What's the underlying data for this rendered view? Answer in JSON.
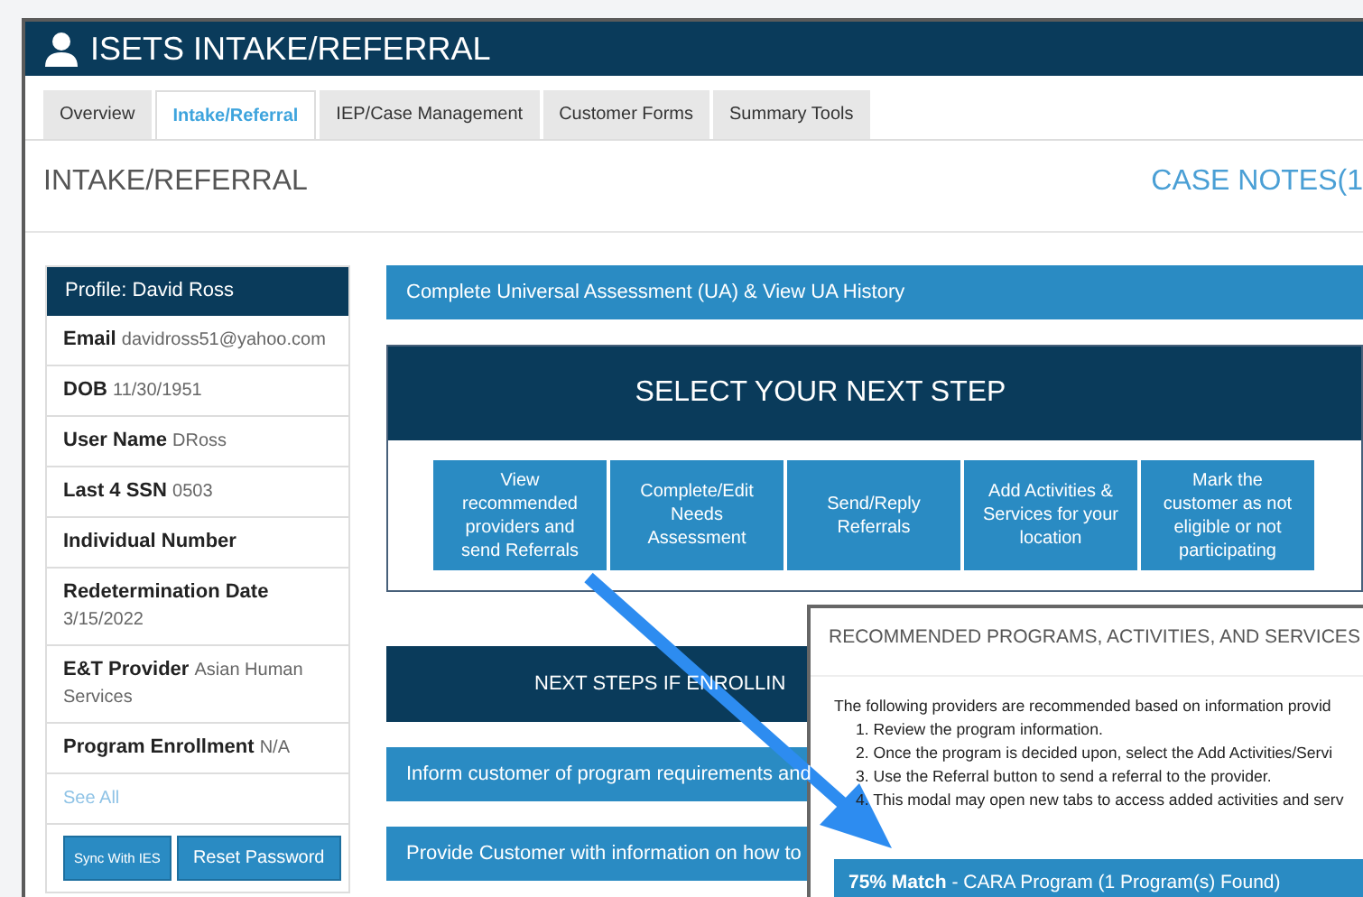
{
  "header": {
    "title": "ISETS INTAKE/REFERRAL"
  },
  "tabs": [
    {
      "label": "Overview",
      "selected": false
    },
    {
      "label": "Intake/Referral",
      "selected": true
    },
    {
      "label": "IEP/Case Management",
      "selected": false
    },
    {
      "label": "Customer Forms",
      "selected": false
    },
    {
      "label": "Summary Tools",
      "selected": false
    }
  ],
  "page_title": "INTAKE/REFERRAL",
  "case_notes_link": "CASE NOTES(1",
  "profile": {
    "title": "Profile: David Ross",
    "fields": [
      {
        "label": "Email",
        "value": "davidross51@yahoo.com"
      },
      {
        "label": "DOB",
        "value": "11/30/1951"
      },
      {
        "label": "User Name",
        "value": "DRoss"
      },
      {
        "label": "Last 4 SSN",
        "value": "0503"
      },
      {
        "label": "Individual Number"
      },
      {
        "label": "Redetermination Date",
        "value": "3/15/2022"
      },
      {
        "label": "E&T Provider",
        "value": "Asian Human Services"
      },
      {
        "label": "Program Enrollment",
        "value": "N/A"
      }
    ],
    "see_all": "See All",
    "buttons": [
      "Sync With IES",
      "Reset Password"
    ]
  },
  "assessment_bar": "Complete Universal Assessment (UA) & View UA History",
  "next_step": {
    "title": "SELECT YOUR NEXT STEP",
    "buttons": [
      "View recommended providers and send Referrals",
      "Complete/Edit Needs Assessment",
      "Send/Reply Referrals",
      "Add Activities & Services for your location",
      "Mark the customer as not eligible or not participating"
    ]
  },
  "enrolling": {
    "title": "NEXT STEPS IF ENROLLIN",
    "bars": [
      "Inform customer of program requirements and",
      "Provide Customer with information on how to"
    ]
  },
  "modal": {
    "title": "RECOMMENDED PROGRAMS, ACTIVITIES, AND SERVICES",
    "intro": "The following providers are recommended based on information provid",
    "steps": [
      "1. Review the program information.",
      "2. Once the program is decided upon, select the Add Activities/Servi",
      "3. Use the Referral button to send a referral to the provider.",
      "4. This modal may open new tabs to access added activities and serv"
    ],
    "match": "**75% Match** - CARA Program (1 Program(s) Found)"
  }
}
